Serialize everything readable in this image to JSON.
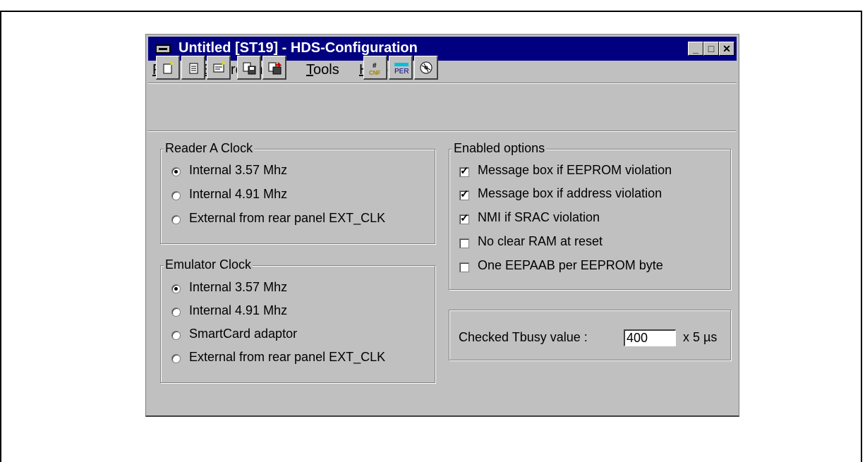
{
  "window": {
    "title": "Untitled [ST19] - HDS-Configuration"
  },
  "menu": {
    "file": {
      "first": "F",
      "rest": "ile"
    },
    "environment": {
      "first": "E",
      "rest": "nvironment"
    },
    "tools": {
      "first": "T",
      "rest": "ools"
    },
    "help": {
      "first": "H",
      "rest": "elp"
    }
  },
  "toolbar": {
    "icons": [
      "new-doc-icon",
      "open-doc-icon",
      "config-doc-icon",
      "save-icon",
      "save-as-icon",
      "cnf-icon",
      "per-icon",
      "cd-icon"
    ],
    "cnf_label": "CNF",
    "per_label": "PER"
  },
  "reader_clock": {
    "title": "Reader A Clock",
    "options": [
      "Internal 3.57 Mhz",
      "Internal 4.91 Mhz",
      "External from rear panel EXT_CLK"
    ],
    "selected": "Internal 3.57 Mhz"
  },
  "emulator_clock": {
    "title": "Emulator Clock",
    "options": [
      "Internal 3.57 Mhz",
      "Internal 4.91 Mhz",
      "SmartCard adaptor",
      "External from rear panel EXT_CLK"
    ],
    "selected": "Internal 3.57 Mhz"
  },
  "enabled_options": {
    "title": "Enabled options",
    "items": [
      {
        "label": "Message box if EEPROM violation",
        "checked": true
      },
      {
        "label": "Message box if address violation",
        "checked": true
      },
      {
        "label": "NMI if SRAC violation",
        "checked": true
      },
      {
        "label": "No clear RAM at reset",
        "checked": false
      },
      {
        "label": "One EEPAAB per EEPROM byte",
        "checked": false
      }
    ]
  },
  "tbusy": {
    "label": "Checked Tbusy value :",
    "value": "400",
    "unit": "x 5 µs"
  }
}
